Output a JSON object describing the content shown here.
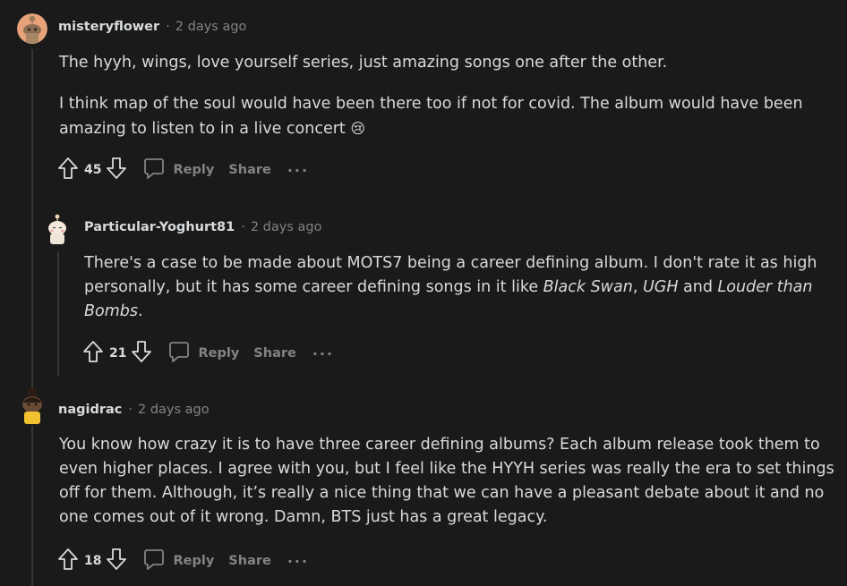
{
  "comments": [
    {
      "author": "misteryflower",
      "separator": "·",
      "time": "2 days ago",
      "paragraphs": [
        "The hyyh, wings, love yourself series, just amazing songs one after the other.",
        "I think map of the soul would have been there too if not for covid. The album would have been amazing to listen to in a live concert"
      ],
      "emoji": "😢",
      "score": "45",
      "reply_label": "Reply",
      "share_label": "Share",
      "more_label": "···"
    },
    {
      "author": "Particular-Yoghurt81",
      "separator": "·",
      "time": "2 days ago",
      "text_parts": [
        "There's a case to be made about MOTS7 being a career defining album. I don't rate it as high personally, but it has some career defining songs in it like ",
        "Black Swan",
        ", ",
        "UGH",
        " and ",
        "Louder than Bombs",
        "."
      ],
      "score": "21",
      "reply_label": "Reply",
      "share_label": "Share",
      "more_label": "···"
    },
    {
      "author": "nagidrac",
      "separator": "·",
      "time": "2 days ago",
      "paragraphs": [
        "You know how crazy it is to have three career defining albums? Each album release took them to even higher places. I agree with you, but I feel like the HYYH series was really the era to set things off for them. Although, it’s really a nice thing that we can have a pleasant debate about it and no one comes out of it wrong. Damn, BTS just has a great legacy."
      ],
      "score": "18",
      "reply_label": "Reply",
      "share_label": "Share",
      "more_label": "···"
    }
  ],
  "colors": {
    "background": "#1a1a1b",
    "text": "#d7dadc",
    "muted": "#818384",
    "thread_line": "#343536"
  },
  "icons": [
    "avatar",
    "upvote-icon",
    "downvote-icon",
    "comment-icon",
    "more-icon",
    "crying-emoji"
  ]
}
